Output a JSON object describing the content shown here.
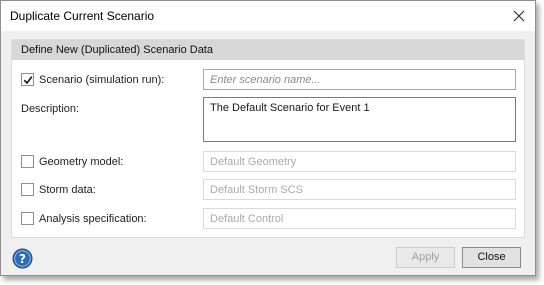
{
  "window": {
    "title": "Duplicate Current Scenario"
  },
  "group": {
    "header": "Define New (Duplicated) Scenario Data"
  },
  "fields": {
    "scenario": {
      "label": "Scenario (simulation run):",
      "checked": true,
      "placeholder": "Enter scenario name..."
    },
    "description": {
      "label": "Description:",
      "value": "The Default Scenario for Event 1"
    },
    "geometry": {
      "label": "Geometry model:",
      "checked": false,
      "value": "Default Geometry"
    },
    "storm": {
      "label": "Storm data:",
      "checked": false,
      "value": "Default Storm SCS"
    },
    "analysis": {
      "label": "Analysis specification:",
      "checked": false,
      "value": "Default Control"
    }
  },
  "buttons": {
    "apply": "Apply",
    "close": "Close"
  },
  "icons": {
    "help": "help-icon",
    "close": "close-icon",
    "check": "checkmark-icon"
  },
  "colors": {
    "help_blue": "#2e6db4",
    "check": "#1a1a1a",
    "header_band": "#d7d7d7"
  }
}
